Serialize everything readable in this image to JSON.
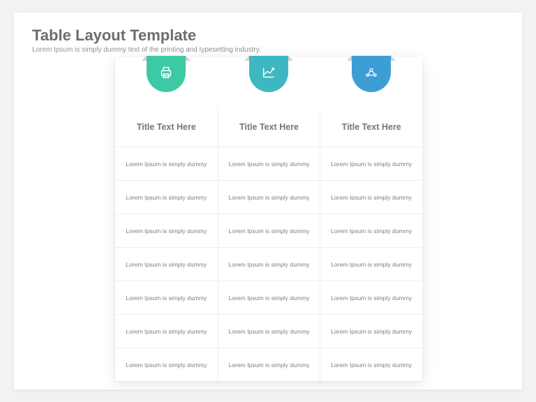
{
  "page": {
    "title": "Table Layout Template",
    "subtitle": "Lorem Ipsum is simply dummy text of the printing and typesetting industry."
  },
  "colors": {
    "col1": "#3dc9a3",
    "col2": "#3fb7c0",
    "col3": "#3f9dd6"
  },
  "columns": [
    {
      "icon": "printer-icon",
      "title": "Title Text Here",
      "rows": [
        "Lorem Ipsum is simply dummy",
        "Lorem Ipsum is simply dummy",
        "Lorem Ipsum is simply dummy",
        "Lorem Ipsum is simply dummy",
        "Lorem Ipsum is simply dummy",
        "Lorem Ipsum is simply dummy",
        "Lorem Ipsum is simply dummy"
      ]
    },
    {
      "icon": "chart-icon",
      "title": "Title Text Here",
      "rows": [
        "Lorem Ipsum is simply dummy",
        "Lorem Ipsum is simply dummy",
        "Lorem Ipsum is simply dummy",
        "Lorem Ipsum is simply dummy",
        "Lorem Ipsum is simply dummy",
        "Lorem Ipsum is simply dummy",
        "Lorem Ipsum is simply dummy"
      ]
    },
    {
      "icon": "network-icon",
      "title": "Title Text Here",
      "rows": [
        "Lorem Ipsum is simply dummy",
        "Lorem Ipsum is simply dummy",
        "Lorem Ipsum is simply dummy",
        "Lorem Ipsum is simply dummy",
        "Lorem Ipsum is simply dummy",
        "Lorem Ipsum is simply dummy",
        "Lorem Ipsum is simply dummy"
      ]
    }
  ]
}
